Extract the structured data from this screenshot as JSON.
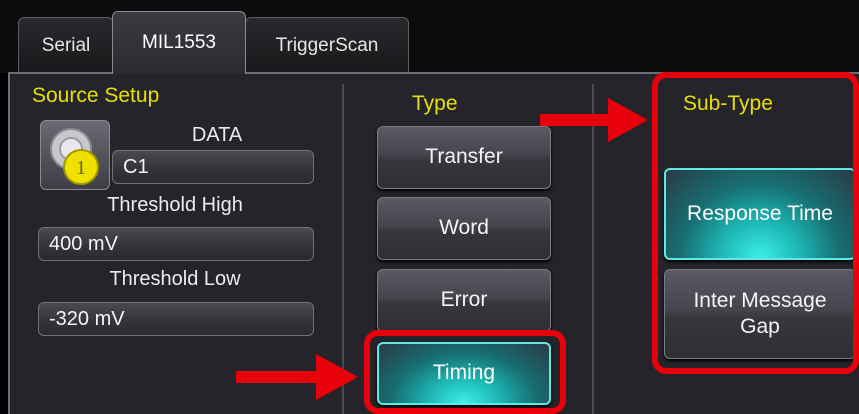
{
  "tabs": [
    {
      "label": "Serial"
    },
    {
      "label": "MIL1553"
    },
    {
      "label": "TriggerScan"
    }
  ],
  "source_setup": {
    "title": "Source Setup",
    "data_label": "DATA",
    "source_value": "C1",
    "source_badge": "1",
    "threshold_high_label": "Threshold High",
    "threshold_high_value": "400 mV",
    "threshold_low_label": "Threshold Low",
    "threshold_low_value": "-320 mV"
  },
  "type": {
    "title": "Type",
    "buttons": [
      "Transfer",
      "Word",
      "Error",
      "Timing"
    ],
    "selected": "Timing"
  },
  "sub_type": {
    "title": "Sub-Type",
    "buttons": [
      "Response Time",
      "Inter Message Gap"
    ],
    "selected": "Response Time"
  },
  "colors": {
    "accent_yellow": "#e8e000",
    "selected_cyan": "#1db6b4",
    "annotation_red": "#e8000a"
  }
}
